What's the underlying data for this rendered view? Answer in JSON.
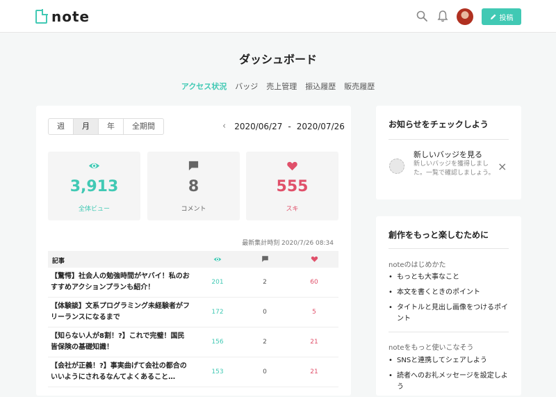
{
  "brand": {
    "name": "note",
    "accent": "#41c9b4",
    "like_color": "#e0506a"
  },
  "header": {
    "post_label": "投稿",
    "icons": [
      "search-icon",
      "bell-icon",
      "pencil-icon"
    ]
  },
  "page": {
    "title": "ダッシュボード"
  },
  "tabs": [
    {
      "label": "アクセス状況",
      "active": true
    },
    {
      "label": "バッジ",
      "active": false
    },
    {
      "label": "売上管理",
      "active": false
    },
    {
      "label": "振込履歴",
      "active": false
    },
    {
      "label": "販売履歴",
      "active": false
    }
  ],
  "period": {
    "options": [
      "週",
      "月",
      "年",
      "全期間"
    ],
    "selected": "月"
  },
  "date_range": {
    "start": "2020/06/27",
    "sep": "-",
    "end": "2020/07/26"
  },
  "stats": [
    {
      "value": "3,913",
      "label": "全体ビュー",
      "icon": "eye-icon"
    },
    {
      "value": "8",
      "label": "コメント",
      "icon": "comment-icon"
    },
    {
      "value": "555",
      "label": "スキ",
      "icon": "heart-icon"
    }
  ],
  "updated": "最新集計時刻 2020/7/26 08:34",
  "table": {
    "header": "記事",
    "rows": [
      {
        "title": "【驚愕】社会人の勉強時間がヤバイ！私のおすすめアクションプランも紹介！",
        "views": "201",
        "comments": "2",
        "likes": "60"
      },
      {
        "title": "【体験談】文系プログラミング未経験者がフリーランスになるまで",
        "views": "172",
        "comments": "0",
        "likes": "5"
      },
      {
        "title": "【知らない人が8割！?】これで完璧！国民皆保険の基礎知識！",
        "views": "156",
        "comments": "2",
        "likes": "21"
      },
      {
        "title": "【会社が正義！?】事実曲げて会社の都合のいいようにされるなんてよくあること…",
        "views": "153",
        "comments": "0",
        "likes": "21"
      }
    ]
  },
  "notice": {
    "heading": "お知らせをチェックしよう",
    "title": "新しいバッジを見る",
    "body": "新しいバッジを獲得しました。一覧で確認しましょう。"
  },
  "tips": {
    "heading": "創作をもっと楽しむために",
    "sections": [
      {
        "title": "noteのはじめかた",
        "items": [
          "もっとも大事なこと",
          "本文を書くときのポイント",
          "タイトルと見出し画像をつけるポイント"
        ]
      },
      {
        "title": "noteをもっと使いこなそう",
        "items": [
          "SNSと連携してシェアしよう",
          "読者へのお礼メッセージを設定しよう"
        ]
      }
    ]
  }
}
